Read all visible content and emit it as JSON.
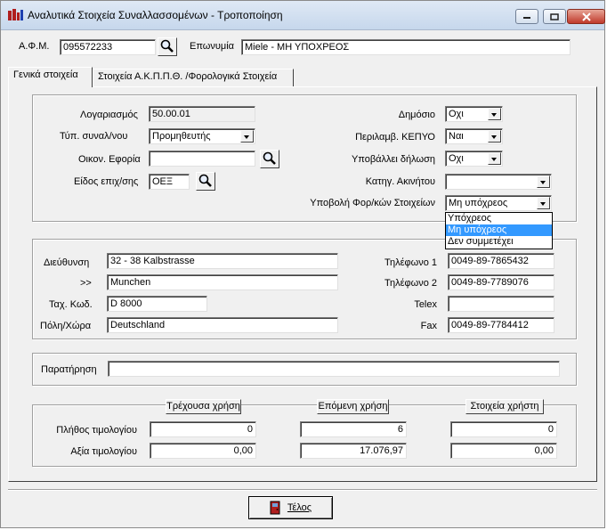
{
  "window": {
    "title": "Αναλυτικά Στοιχεία Συναλλασσομένων - Τροποποίηση"
  },
  "header": {
    "afm_label": "Α.Φ.Μ.",
    "afm_value": "095572233",
    "name_label": "Επωνυμία",
    "name_value": "Miele - ΜΗ ΥΠΟΧΡΕΟΣ"
  },
  "tabs": [
    {
      "label": "Γενικά στοιχεία",
      "active": true
    },
    {
      "label": "Στοιχεία Α.Κ.Π.Π.Θ. /Φορολογικά  Στοιχεία",
      "active": false
    }
  ],
  "general": {
    "account_label": "Λογαριασμός",
    "account_value": "50.00.01",
    "type_label": "Τύπ. συναλ/νου",
    "type_value": "Προμηθευτής",
    "tax_office_label": "Οικον. Εφορία",
    "tax_office_value": "",
    "business_label": "Είδος επιχ/σης",
    "business_value": "ΟΕΞ",
    "public_label": "Δημόσιο",
    "public_value": "Οχι",
    "kepyo_label": "Περιλαμβ. ΚΕΠΥΟ",
    "kepyo_value": "Ναι",
    "declaration_label": "Υποβάλλει δήλωση",
    "declaration_value": "Οχι",
    "property_label": "Κατηγ. Ακινήτου",
    "property_value": "",
    "submission_label": "Υποβολή Φορ/κών Στοιχείων",
    "submission_value": "Μη υπόχρεος",
    "submission_options": [
      "Υπόχρεος",
      "Μη υπόχρεος",
      "Δεν συμμετέχει"
    ],
    "submission_selected_index": 1
  },
  "address": {
    "address_label": "Διεύθυνση",
    "address_value": "32 - 38 Kalbstrasse",
    "address2_label": ">>",
    "address2_value": "Munchen",
    "zip_label": "Ταχ. Κωδ.",
    "zip_value": "D  8000",
    "city_label": "Πόλη/Χώρα",
    "city_value": "Deutschland",
    "phone1_label": "Τηλέφωνο 1",
    "phone1_value": "0049-89-7865432",
    "phone2_label": "Τηλέφωνο 2",
    "phone2_value": "0049-89-7789076",
    "telex_label": "Telex",
    "telex_value": "",
    "fax_label": "Fax",
    "fax_value": "0049-89-7784412"
  },
  "remarks": {
    "label": "Παρατήρηση",
    "value": ""
  },
  "stats": {
    "columns": [
      "Τρέχουσα χρήση",
      "Επόμενη χρήση",
      "Στοιχεία χρήστη"
    ],
    "rows": [
      {
        "label": "Πλήθος τιμολογίου",
        "values": [
          "0",
          "6",
          "0"
        ]
      },
      {
        "label": "Αξία τιμολογίου",
        "values": [
          "0,00",
          "17.076,97",
          "0,00"
        ]
      }
    ]
  },
  "footer": {
    "end_button": "Τέλος"
  },
  "colors": {
    "title_gradient_top": "#dfe9f5",
    "selection": "#3399ff",
    "close_button": "#c0392b"
  },
  "icons": {
    "lookup": "magnifier-icon",
    "app": "app-logo-icon",
    "end_button": "exit-door-icon"
  }
}
